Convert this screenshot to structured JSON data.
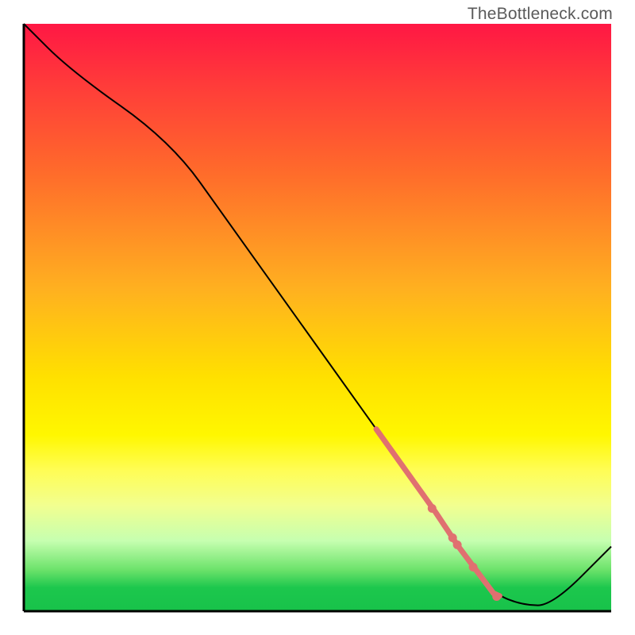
{
  "chart_data": {
    "type": "line",
    "title": "",
    "watermark": "TheBottleneck.com",
    "xlabel": "",
    "ylabel": "",
    "xlim": [
      0,
      100
    ],
    "ylim": [
      0,
      100
    ],
    "grid": false,
    "legend": false,
    "x": [
      0,
      8,
      25,
      35,
      45,
      55,
      60,
      65,
      70,
      74,
      77,
      80,
      85,
      90,
      100
    ],
    "y": [
      100,
      92,
      80,
      66,
      52,
      38,
      31,
      24,
      17,
      11,
      7,
      3,
      1,
      1,
      11
    ],
    "highlight_band": {
      "x_start": 60,
      "x_end": 81,
      "color": "#e07070",
      "width": 7
    },
    "dots": [
      {
        "x": 69.5,
        "y": 17.5
      },
      {
        "x": 73.0,
        "y": 12.5
      },
      {
        "x": 73.8,
        "y": 11.3
      },
      {
        "x": 76.5,
        "y": 7.5
      },
      {
        "x": 80.5,
        "y": 2.5
      }
    ],
    "dot_color": "#e07070",
    "curve_stroke": "#000000",
    "background_gradient": [
      "#ff1744",
      "#ffe000",
      "#18c24a"
    ]
  }
}
